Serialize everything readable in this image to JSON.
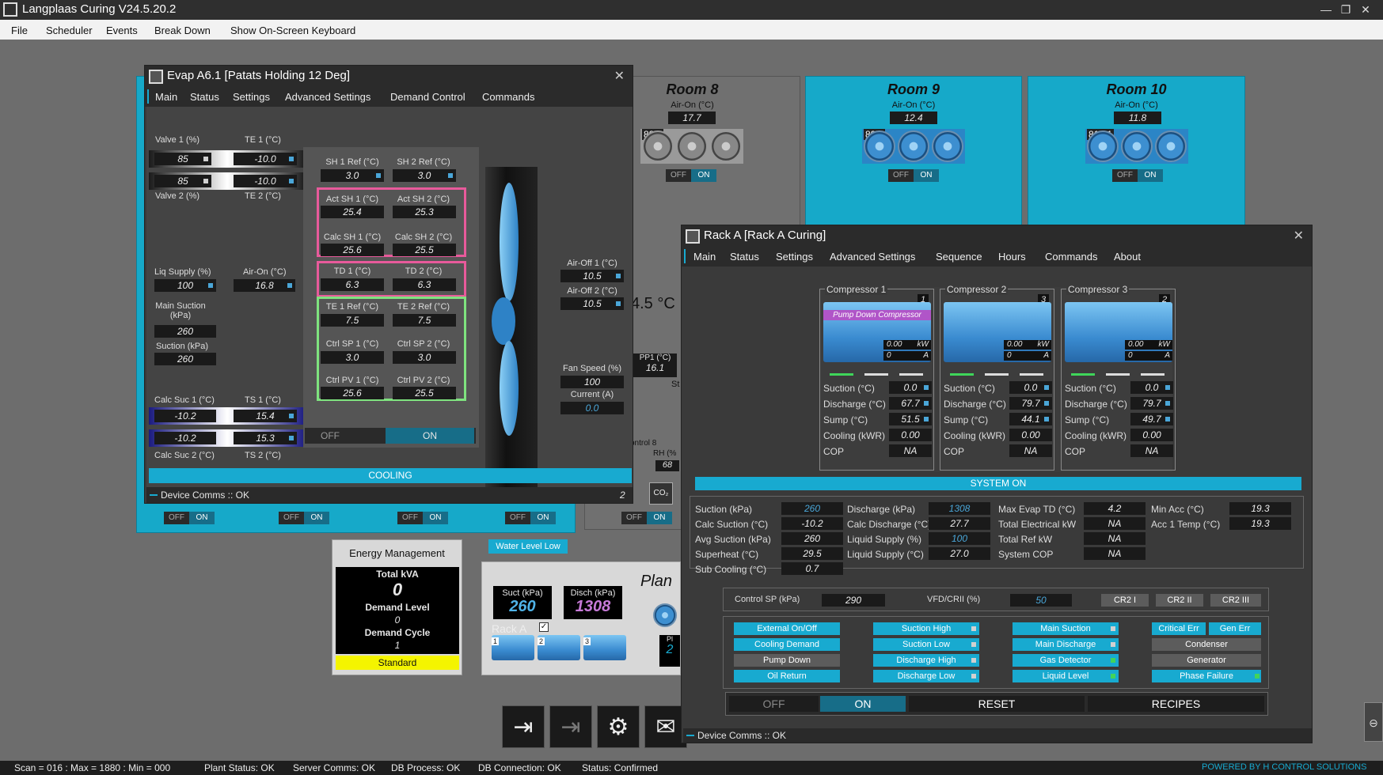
{
  "window": {
    "title": "Langplaas Curing V24.5.20.2"
  },
  "menu": [
    "File",
    "Scheduler",
    "Events",
    "Break Down",
    "Show On-Screen Keyboard"
  ],
  "rooms": [
    {
      "name": "Room 8",
      "air_on_label": "Air-On (°C)",
      "air_on": "17.7",
      "fan_id": "88.1",
      "off": "OFF",
      "on": "ON"
    },
    {
      "name": "Room 9",
      "air_on_label": "Air-On (°C)",
      "air_on": "12.4",
      "fan_id": "89.1",
      "off": "OFF",
      "on": "ON"
    },
    {
      "name": "Room 10",
      "air_on_label": "Air-On (°C)",
      "air_on": "11.8",
      "fan_id": "810.1",
      "off": "OFF",
      "on": "ON"
    }
  ],
  "background": {
    "temp_partial": "4.5 °C",
    "pp1_label": "PP1 (°C)",
    "pp1": "16.1",
    "st_partial": "St",
    "control_partial": "ontrol 8",
    "rh_label": "RH (%",
    "rh": "68",
    "co2": "CO₂",
    "onoff": [
      {
        "off": "OFF",
        "on": "ON"
      },
      {
        "off": "OFF",
        "on": "ON"
      },
      {
        "off": "OFF",
        "on": "ON"
      },
      {
        "off": "OFF",
        "on": "ON"
      },
      {
        "off": "OFF",
        "on": "ON"
      }
    ],
    "water_level": "Water Level Low",
    "plan_partial": "Plan",
    "pl_partial": "Pl",
    "two_partial": "2",
    "suct_label": "Suct (kPa)",
    "suct": "260",
    "disch_label": "Disch (kPa)",
    "disch": "1308",
    "rack_label": "Rack A",
    "comp_nums": [
      "1",
      "2",
      "3"
    ]
  },
  "energy": {
    "title": "Energy Management",
    "total_kva_label": "Total kVA",
    "total_kva": "0",
    "demand_level_label": "Demand Level",
    "demand_level": "0",
    "demand_cycle_label": "Demand Cycle",
    "demand_cycle": "1",
    "mode": "Standard"
  },
  "evap": {
    "title": "Evap A6.1 [Patats Holding 12 Deg]",
    "tabs": [
      "Main",
      "Status",
      "Settings",
      "Advanced Settings",
      "Demand Control",
      "Commands"
    ],
    "valve1_label": "Valve 1 (%)",
    "te1_label": "TE 1 (°C)",
    "valve1": "85",
    "te1": "-10.0",
    "valve1b": "85",
    "te1b": "-10.0",
    "valve2_label": "Valve 2 (%)",
    "te2_label": "TE 2 (°C)",
    "liq_label": "Liq Supply (%)",
    "liq": "100",
    "airon_label": "Air-On (°C)",
    "airon": "16.8",
    "main_suction_label": "Main Suction (kPa)",
    "main_suction": "260",
    "suction_label": "Suction (kPa)",
    "suction": "260",
    "calc_suc1_label": "Calc Suc 1 (°C)",
    "ts1_label": "TS 1 (°C)",
    "calc_suc1": "-10.2",
    "ts1": "15.4",
    "calc_suc1b": "-10.2",
    "ts1b": "15.3",
    "calc_suc2_label": "Calc Suc 2 (°C)",
    "ts2_label": "TS 2 (°C)",
    "sh1ref_label": "SH 1 Ref (°C)",
    "sh1ref": "3.0",
    "sh2ref_label": "SH 2 Ref (°C)",
    "sh2ref": "3.0",
    "actsh1_label": "Act SH 1 (°C)",
    "actsh1": "25.4",
    "actsh2_label": "Act SH 2 (°C)",
    "actsh2": "25.3",
    "calcsh1_label": "Calc SH 1 (°C)",
    "calcsh1": "25.6",
    "calcsh2_label": "Calc SH 2 (°C)",
    "calcsh2": "25.5",
    "td1_label": "TD 1 (°C)",
    "td1": "6.3",
    "td2_label": "TD 2 (°C)",
    "td2": "6.3",
    "te1ref_label": "TE 1 Ref (°C)",
    "te1ref": "7.5",
    "te2ref_label": "TE 2 Ref (°C)",
    "te2ref": "7.5",
    "ctrlsp1_label": "Ctrl SP 1 (°C)",
    "ctrlsp1": "3.0",
    "ctrlsp2_label": "Ctrl SP 2 (°C)",
    "ctrlsp2": "3.0",
    "ctrlpv1_label": "Ctrl PV 1 (°C)",
    "ctrlpv1": "25.6",
    "ctrlpv2_label": "Ctrl PV 2 (°C)",
    "ctrlpv2": "25.5",
    "off": "OFF",
    "on": "ON",
    "airoff1_label": "Air-Off 1 (°C)",
    "airoff1": "10.5",
    "airoff2_label": "Air-Off 2 (°C)",
    "airoff2": "10.5",
    "fanspeed_label": "Fan Speed (%)",
    "fanspeed": "100",
    "current_label": "Current (A)",
    "current": "0.0",
    "mode": "COOLING",
    "comms": "Device Comms :: OK",
    "page": "2"
  },
  "rack": {
    "title": "Rack A [Rack A Curing]",
    "tabs": [
      "Main",
      "Status",
      "Settings",
      "Advanced Settings",
      "Sequence",
      "Hours",
      "Commands",
      "About"
    ],
    "compressors": [
      {
        "name": "Compressor 1",
        "num": "1",
        "banner": "Pump Down Compressor",
        "kw": "0.00",
        "kw_unit": "kW",
        "a": "0",
        "a_unit": "A",
        "suction": "0.0",
        "discharge": "67.7",
        "sump": "51.5",
        "cooling": "0.00",
        "cop": "NA"
      },
      {
        "name": "Compressor 2",
        "num": "3",
        "banner": "",
        "kw": "0.00",
        "kw_unit": "kW",
        "a": "0",
        "a_unit": "A",
        "suction": "0.0",
        "discharge": "79.7",
        "sump": "44.1",
        "cooling": "0.00",
        "cop": "NA"
      },
      {
        "name": "Compressor 3",
        "num": "2",
        "banner": "",
        "kw": "0.00",
        "kw_unit": "kW",
        "a": "0",
        "a_unit": "A",
        "suction": "0.0",
        "discharge": "79.7",
        "sump": "49.7",
        "cooling": "0.00",
        "cop": "NA"
      }
    ],
    "comp_labels": {
      "suction": "Suction (°C)",
      "discharge": "Discharge (°C)",
      "sump": "Sump (°C)",
      "cooling": "Cooling (kWR)",
      "cop": "COP"
    },
    "system_status": "SYSTEM ON",
    "col1": [
      {
        "label": "Suction (kPa)",
        "value": "260"
      },
      {
        "label": "Calc Suction (°C)",
        "value": "-10.2"
      },
      {
        "label": "Avg Suction (kPa)",
        "value": "260"
      },
      {
        "label": "Superheat (°C)",
        "value": "29.5"
      },
      {
        "label": "Sub Cooling (°C)",
        "value": "0.7"
      }
    ],
    "col2": [
      {
        "label": "Discharge (kPa)",
        "value": "1308"
      },
      {
        "label": "Calc Discharge (°C)",
        "value": "27.7"
      },
      {
        "label": "Liquid Supply (%)",
        "value": "100"
      },
      {
        "label": "Liquid Supply (°C)",
        "value": "27.0"
      }
    ],
    "col3": [
      {
        "label": "Max Evap TD (°C)",
        "value": "4.2"
      },
      {
        "label": "Total Electrical kW",
        "value": "NA"
      },
      {
        "label": "Total Ref kW",
        "value": "NA"
      },
      {
        "label": "System COP",
        "value": "NA"
      }
    ],
    "col4": [
      {
        "label": "Min Acc (°C)",
        "value": "19.3"
      },
      {
        "label": "Acc 1 Temp (°C)",
        "value": "19.3"
      }
    ],
    "control_sp_label": "Control SP (kPa)",
    "control_sp": "290",
    "vfd_label": "VFD/CRII (%)",
    "vfd": "50",
    "cr_buttons": [
      "CR2 I",
      "CR2 II",
      "CR2 III"
    ],
    "alarms": [
      [
        "External On/Off",
        "Cooling Demand",
        "Pump Down",
        "Oil Return"
      ],
      [
        "Suction High",
        "Suction Low",
        "Discharge High",
        "Discharge Low"
      ],
      [
        "Main Suction",
        "Main Discharge",
        "Gas Detector",
        "Liquid Level"
      ],
      [
        "Critical Err",
        "Gen Err",
        "Condenser",
        "Generator",
        "Phase Failure"
      ]
    ],
    "off": "OFF",
    "on": "ON",
    "reset": "RESET",
    "recipes": "RECIPES",
    "comms": "Device Comms :: OK"
  },
  "status_bar": {
    "scan": "Scan = 016 : Max = 1880 : Min = 000",
    "plant": "Plant Status: OK",
    "server": "Server Comms: OK",
    "db_process": "DB Process: OK",
    "db_conn": "DB Connection: OK",
    "status": "Status: Confirmed",
    "powered": "POWERED BY H CONTROL SOLUTIONS"
  }
}
